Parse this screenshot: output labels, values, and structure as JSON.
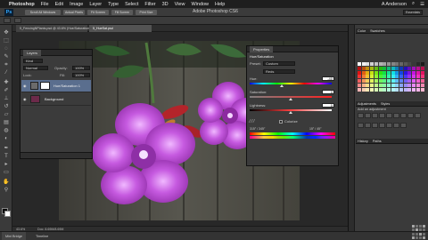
{
  "menubar": {
    "items": [
      "Photoshop",
      "File",
      "Edit",
      "Image",
      "Layer",
      "Type",
      "Select",
      "Filter",
      "3D",
      "View",
      "Window",
      "Help"
    ],
    "user": "A Anderson"
  },
  "appbar": {
    "title": "Adobe Photoshop CS6",
    "buttons": [
      "Scroll All Windows",
      "Actual Pixels",
      "Fit Screen",
      "Fill Screen",
      "Print Size"
    ],
    "workspace": "Essentials"
  },
  "document": {
    "tabs": [
      "5_FencingNPlants.psd @ 43.6% (Hue/Saturation 1, Layer Mask/8) *",
      "5_HueSat.psd"
    ]
  },
  "layers_panel": {
    "tab": "Layers",
    "kind": "Kind",
    "blend_mode": "Normal",
    "opacity_label": "Opacity:",
    "opacity_value": "100%",
    "lock_label": "Lock:",
    "fill_label": "Fill:",
    "fill_value": "100%",
    "layers": [
      {
        "name": "Hue/Saturation 1",
        "selected": true
      },
      {
        "name": "Background",
        "selected": false
      }
    ]
  },
  "properties_panel": {
    "tab": "Properties",
    "title": "Hue/Saturation",
    "preset_label": "Preset:",
    "preset_value": "Custom",
    "channel_value": "Reds",
    "hue_label": "Hue:",
    "hue_value": "-40",
    "hue_level": 0.39,
    "saturation_label": "Saturation:",
    "saturation_value": "0",
    "saturation_level": 0.5,
    "lightness_label": "Lightness:",
    "lightness_value": "0",
    "lightness_level": 0.5,
    "colorize_label": "Colorize",
    "range_left": "315° / 345°",
    "range_right": "15° / 45°"
  },
  "dock": {
    "color_tab": "Color",
    "swatches_tab": "Swatches",
    "adjustments_tab": "Adjustments",
    "styles_tab": "Styles",
    "add_adjustment": "Add an adjustment",
    "history_tab": "History",
    "paths_tab": "Paths"
  },
  "status": {
    "zoom": "43.6%",
    "doc": "Doc: 8.69M/8.69M"
  },
  "bottom": {
    "mini_bridge": "Mini Bridge",
    "timeline": "Timeline"
  },
  "colors": {
    "flower": "#c25ad6",
    "fence": "#4f4f47",
    "accent": "#5a6e8e"
  }
}
